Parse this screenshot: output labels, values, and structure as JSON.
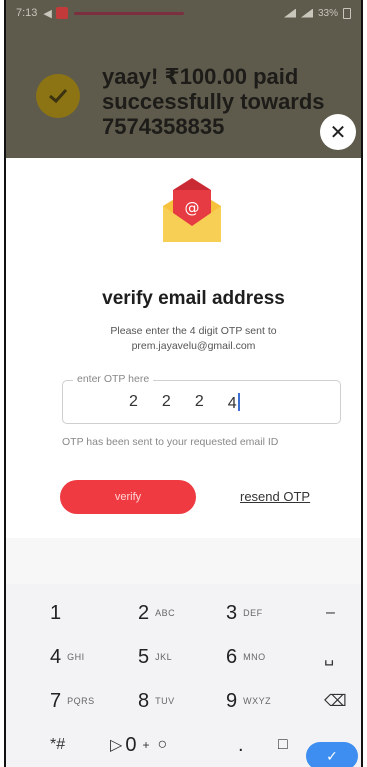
{
  "status_bar": {
    "time": "7:13",
    "battery": "33%"
  },
  "payment": {
    "message": "yaay! ₹100.00 paid successfully towards 7574358835"
  },
  "modal": {
    "title": "verify email address",
    "description_line1": "Please enter the 4 digit OTP sent to",
    "email": "prem.jayavelu@gmail.com",
    "otp_label": "enter OTP here",
    "otp_digits": [
      "2",
      "2",
      "2",
      "4"
    ],
    "otp_hint": "OTP has been sent to your requested email ID",
    "verify_label": "verify",
    "resend_label": "resend OTP"
  },
  "keyboard": {
    "rows": [
      [
        {
          "num": "1",
          "sub": ""
        },
        {
          "num": "2",
          "sub": "ABC"
        },
        {
          "num": "3",
          "sub": "DEF"
        },
        {
          "sym": "–"
        }
      ],
      [
        {
          "num": "4",
          "sub": "GHI"
        },
        {
          "num": "5",
          "sub": "JKL"
        },
        {
          "num": "6",
          "sub": "MNO"
        },
        {
          "sym": "␣"
        }
      ],
      [
        {
          "num": "7",
          "sub": "PQRS"
        },
        {
          "num": "8",
          "sub": "TUV"
        },
        {
          "num": "9",
          "sub": "WXYZ"
        },
        {
          "sym": "⌫"
        }
      ]
    ],
    "bottom": {
      "star_hash": "*#",
      "zero": "0",
      "plus": "+",
      "circle": "○",
      "dot": ".",
      "square": "□",
      "done": "✓"
    }
  },
  "colors": {
    "accent": "#ee3a40",
    "done_blue": "#3d8ef0",
    "envelope_yellow": "#f6c23b"
  }
}
